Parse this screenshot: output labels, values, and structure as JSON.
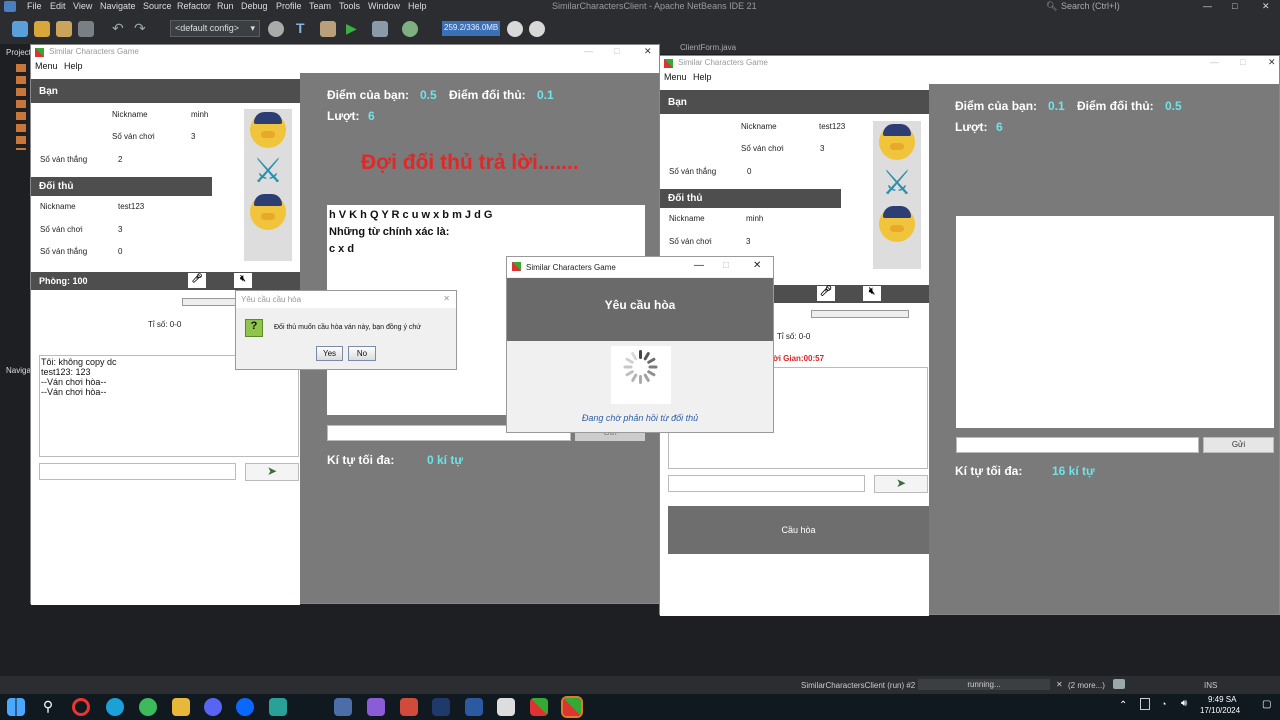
{
  "ide": {
    "menu": [
      "File",
      "Edit",
      "View",
      "Navigate",
      "Source",
      "Refactor",
      "Run",
      "Debug",
      "Profile",
      "Team",
      "Tools",
      "Window",
      "Help"
    ],
    "title": "SimilarCharactersClient - Apache NetBeans IDE 21",
    "search_placeholder": "Search (Ctrl+I)",
    "config": "<default config>",
    "memory": "259.2/336.0MB",
    "left_labels": {
      "projects": "Projects",
      "navigator": "Navigator"
    },
    "status": {
      "run_label": "SimilarCharactersClient (run) #2",
      "progress": "running...",
      "more": "(2 more...)",
      "mode": "INS"
    },
    "behind_tab": "ClientForm.java"
  },
  "taskbar": {
    "time": "9:49 SA",
    "date": "17/10/2024"
  },
  "left_window": {
    "title": "Similar Characters Game",
    "menu": [
      "Menu",
      "Help"
    ],
    "self_header": "Bạn",
    "self": {
      "nickname_label": "Nickname",
      "nickname": "minh",
      "games_label": "Số ván chơi",
      "games": "3",
      "wins_label": "Số ván thắng",
      "wins": "2"
    },
    "opp_header": "Đối thủ",
    "opp": {
      "nickname_label": "Nickname",
      "nickname": "test123",
      "games_label": "Số ván chơi",
      "games": "3",
      "wins_label": "Số ván thắng",
      "wins": "0"
    },
    "room": "Phòng: 100",
    "ratio": "Tỉ số: 0-0",
    "chat_lines": [
      "Tôi: không copy dc",
      "test123: 123",
      "--Ván chơi hòa--",
      "--Ván chơi hòa--"
    ],
    "score_label": "Điểm của bạn:",
    "score": "0.5",
    "opp_score_label": "Điểm đối thủ:",
    "opp_score": "0.1",
    "turn_label": "Lượt:",
    "turn": "6",
    "waiting": "Đợi đối thủ trả lời.......",
    "letters": "h V K h Q Y R c u w x b m J d G",
    "correct_label": "Những từ chính xác là:",
    "correct_words": "c x d",
    "send_label": "Gửi",
    "maxchar_label": "Kí tự tối đa:",
    "maxchar": "0 kí tự"
  },
  "confirm_dialog": {
    "title": "Yêu cầu cầu hòa",
    "message": "Đối thủ muốn cầu hòa ván này, bạn đồng ý chứ",
    "yes": "Yes",
    "no": "No"
  },
  "right_window": {
    "title": "Similar Characters Game",
    "menu": [
      "Menu",
      "Help"
    ],
    "self_header": "Bạn",
    "self": {
      "nickname_label": "Nickname",
      "nickname": "test123",
      "games_label": "Số ván chơi",
      "games": "3",
      "wins_label": "Số ván thắng",
      "wins": "0"
    },
    "opp_header": "Đối thủ",
    "opp": {
      "nickname_label": "Nickname",
      "nickname": "minh",
      "games_label": "Số ván chơi",
      "games": "3"
    },
    "ratio": "Tỉ số: 0-0",
    "timer": "ời Gian:00:57",
    "score_label": "Điểm của bạn:",
    "score": "0.1",
    "opp_score_label": "Điểm đối thủ:",
    "opp_score": "0.5",
    "turn_label": "Lượt:",
    "turn": "6",
    "send_label": "Gửi",
    "maxchar_label": "Kí tự tối đa:",
    "maxchar": "16 kí tự",
    "draw_button": "Cầu hòa"
  },
  "wait_dialog": {
    "title": "Similar Characters Game",
    "header": "Yêu cầu hòa",
    "status": "Đang chờ phản hồi từ đối thủ"
  }
}
